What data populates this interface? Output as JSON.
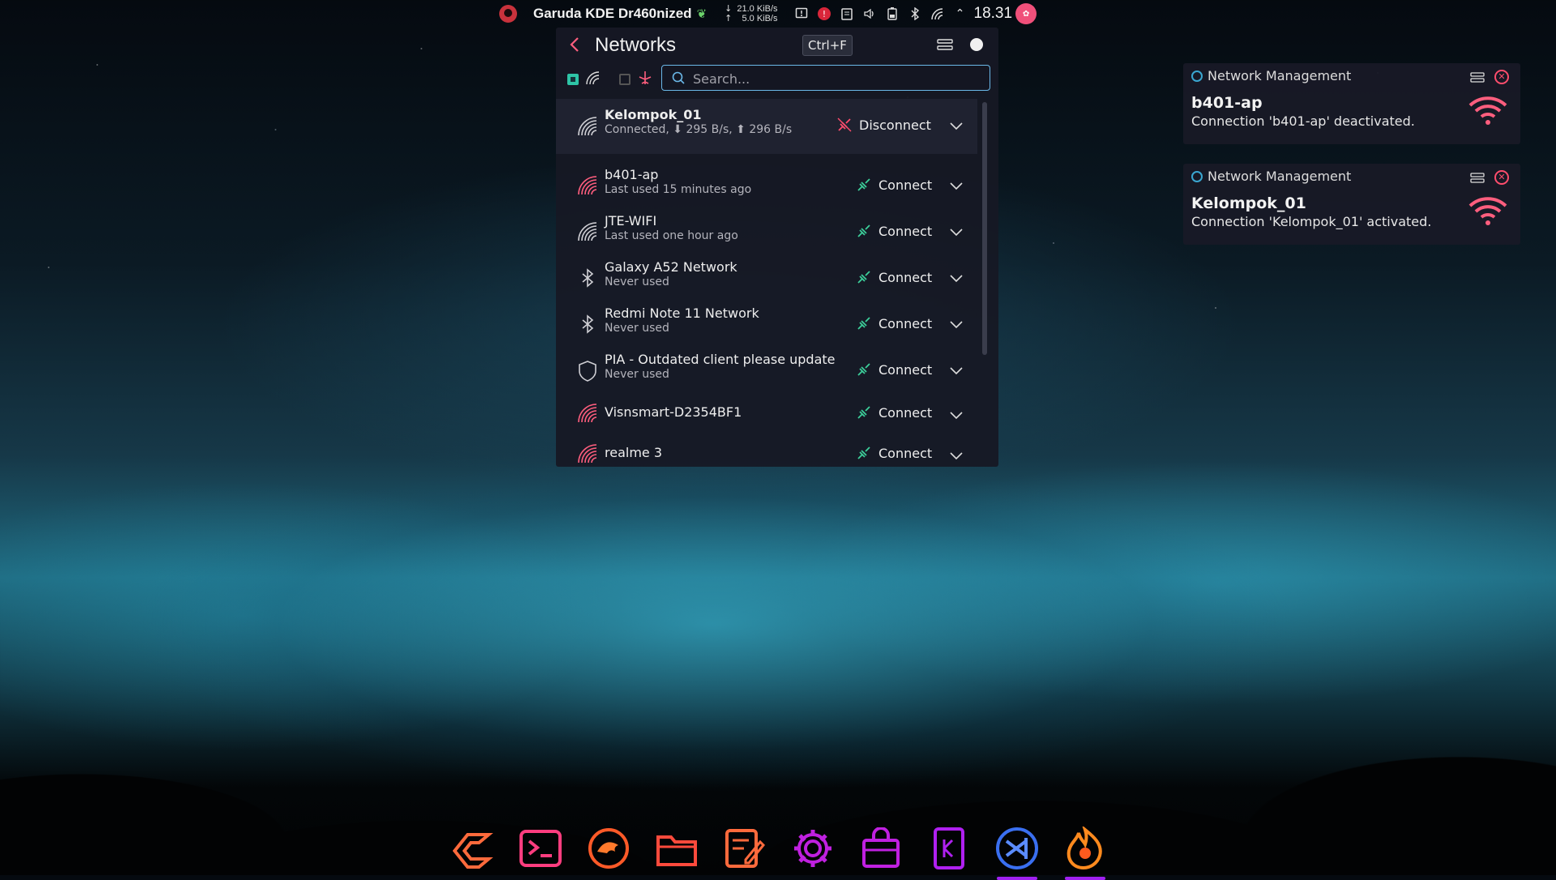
{
  "panel": {
    "app_title": "Garuda KDE Dr460nized",
    "net_down": "21.0 KiB/s",
    "net_up": "5.0 KiB/s",
    "clock": "18.31"
  },
  "networks_popup": {
    "title": "Networks",
    "shortcut": "Ctrl+F",
    "search_placeholder": "Search...",
    "networks": [
      {
        "name": "Kelompok_01",
        "status": "Connected, ⬇ 295 B/s, ⬆ 296 B/s",
        "action": "Disconnect",
        "icon": "wifi-icon"
      },
      {
        "name": "b401-ap",
        "status": "Last used 15 minutes ago",
        "action": "Connect",
        "icon": "wifi-icon"
      },
      {
        "name": "JTE-WIFI",
        "status": "Last used one hour ago",
        "action": "Connect",
        "icon": "wifi-icon"
      },
      {
        "name": "Galaxy A52 Network",
        "status": "Never used",
        "action": "Connect",
        "icon": "bluetooth-icon"
      },
      {
        "name": "Redmi Note 11 Network",
        "status": "Never used",
        "action": "Connect",
        "icon": "bluetooth-icon"
      },
      {
        "name": "PIA -  Outdated client please update",
        "status": "Never used",
        "action": "Connect",
        "icon": "vpn-shield-icon"
      },
      {
        "name": "Visnsmart-D2354BF1",
        "status": "",
        "action": "Connect",
        "icon": "wifi-icon"
      },
      {
        "name": "realme 3",
        "status": "",
        "action": "Connect",
        "icon": "wifi-icon"
      }
    ]
  },
  "notifications": [
    {
      "app": "Network Management",
      "title": "b401-ap",
      "body": "Connection 'b401-ap' deactivated."
    },
    {
      "app": "Network Management",
      "title": "Kelompok_01",
      "body": "Connection 'Kelompok_01' activated."
    }
  ],
  "dock": [
    "garuda-icon",
    "terminal-icon",
    "garuda-welcome-icon",
    "files-icon",
    "text-editor-icon",
    "settings-icon",
    "software-store-icon",
    "kde-connect-icon",
    "vscode-icon",
    "firedragon-icon"
  ],
  "colors": {
    "accent": "#ff5e7e",
    "teal": "#2ec4a6",
    "search_border": "#6bb8e8",
    "popup_bg": "#16182a"
  }
}
